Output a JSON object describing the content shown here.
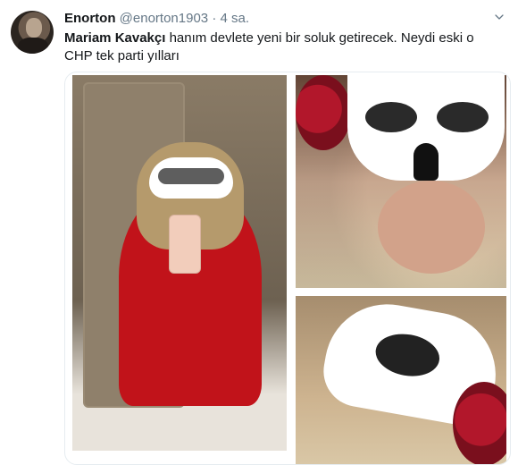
{
  "tweet": {
    "author_name": "Enorton",
    "author_handle": "@enorton1903",
    "separator": "·",
    "time": "4 sa.",
    "text_strong": "Mariam Kavakçı",
    "text_rest": " hanım devlete yeni bir soluk getirecek. Neydi eski o CHP tek parti yılları"
  },
  "icons": {
    "more": "chevron-down-icon"
  },
  "colors": {
    "text_primary": "#14171a",
    "text_secondary": "#657786",
    "border": "#e6ecf0"
  }
}
